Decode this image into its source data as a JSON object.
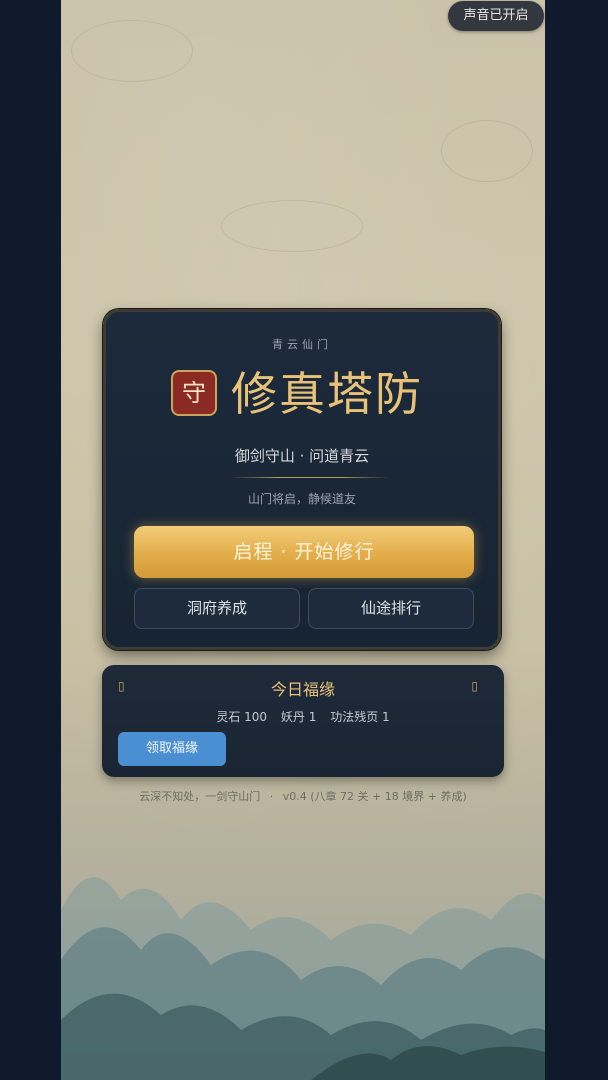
{
  "sound_toggle": {
    "label": "声音已开启"
  },
  "title_card": {
    "sect_name": "青云仙门",
    "seal_char": "守",
    "game_title": "修真塔防",
    "subtitle": "御剑守山 · 问道青云",
    "tagline": "山门将启，静候道友",
    "start_button": "启程 · 开始修行",
    "cave_button": "洞府养成",
    "rank_button": "仙途排行"
  },
  "fortune": {
    "title": "今日福缘",
    "mark": "▯",
    "rewards": [
      "灵石 100",
      "妖丹 1",
      "功法残页 1"
    ],
    "claim_button": "领取福缘"
  },
  "footer": {
    "motto": "云深不知处，一剑守山门",
    "separator": "·",
    "version": "v0.4 (八章 72 关 + 18 境界 + 养成)"
  },
  "colors": {
    "accent_gold": "#e8c277",
    "button_gold": "#e2ad4a",
    "claim_blue": "#4a8fd2",
    "panel_navy": "#1c2a3b",
    "page_bg": "#0f1b2c"
  }
}
